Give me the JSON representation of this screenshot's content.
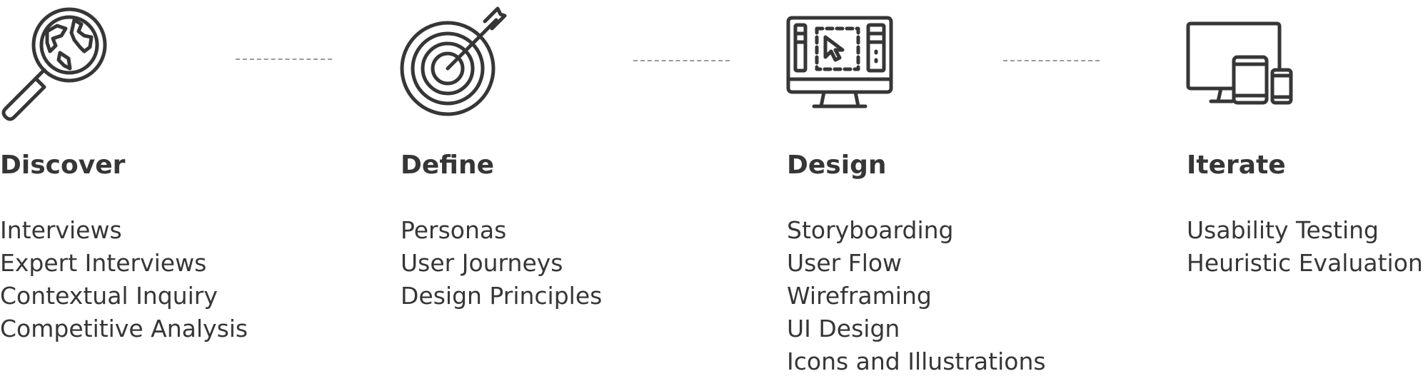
{
  "colors": {
    "ink": "#363636",
    "connector": "#9a9a9a",
    "background": "#ffffff"
  },
  "stages": [
    {
      "icon": "globe-magnifier-icon",
      "title": "Discover",
      "items": [
        "Interviews",
        "Expert Interviews",
        "Contextual Inquiry",
        "Competitive Analysis"
      ]
    },
    {
      "icon": "target-arrow-icon",
      "title": "Define",
      "items": [
        "Personas",
        "User Journeys",
        "Design Principles"
      ]
    },
    {
      "icon": "monitor-wireframe-icon",
      "title": "Design",
      "items": [
        "Storyboarding",
        "User Flow",
        "Wireframing",
        "UI Design",
        "Icons and Illustrations"
      ]
    },
    {
      "icon": "responsive-devices-icon",
      "title": "Iterate",
      "items": [
        "Usability Testing",
        "Heuristic Evaluation"
      ]
    }
  ]
}
